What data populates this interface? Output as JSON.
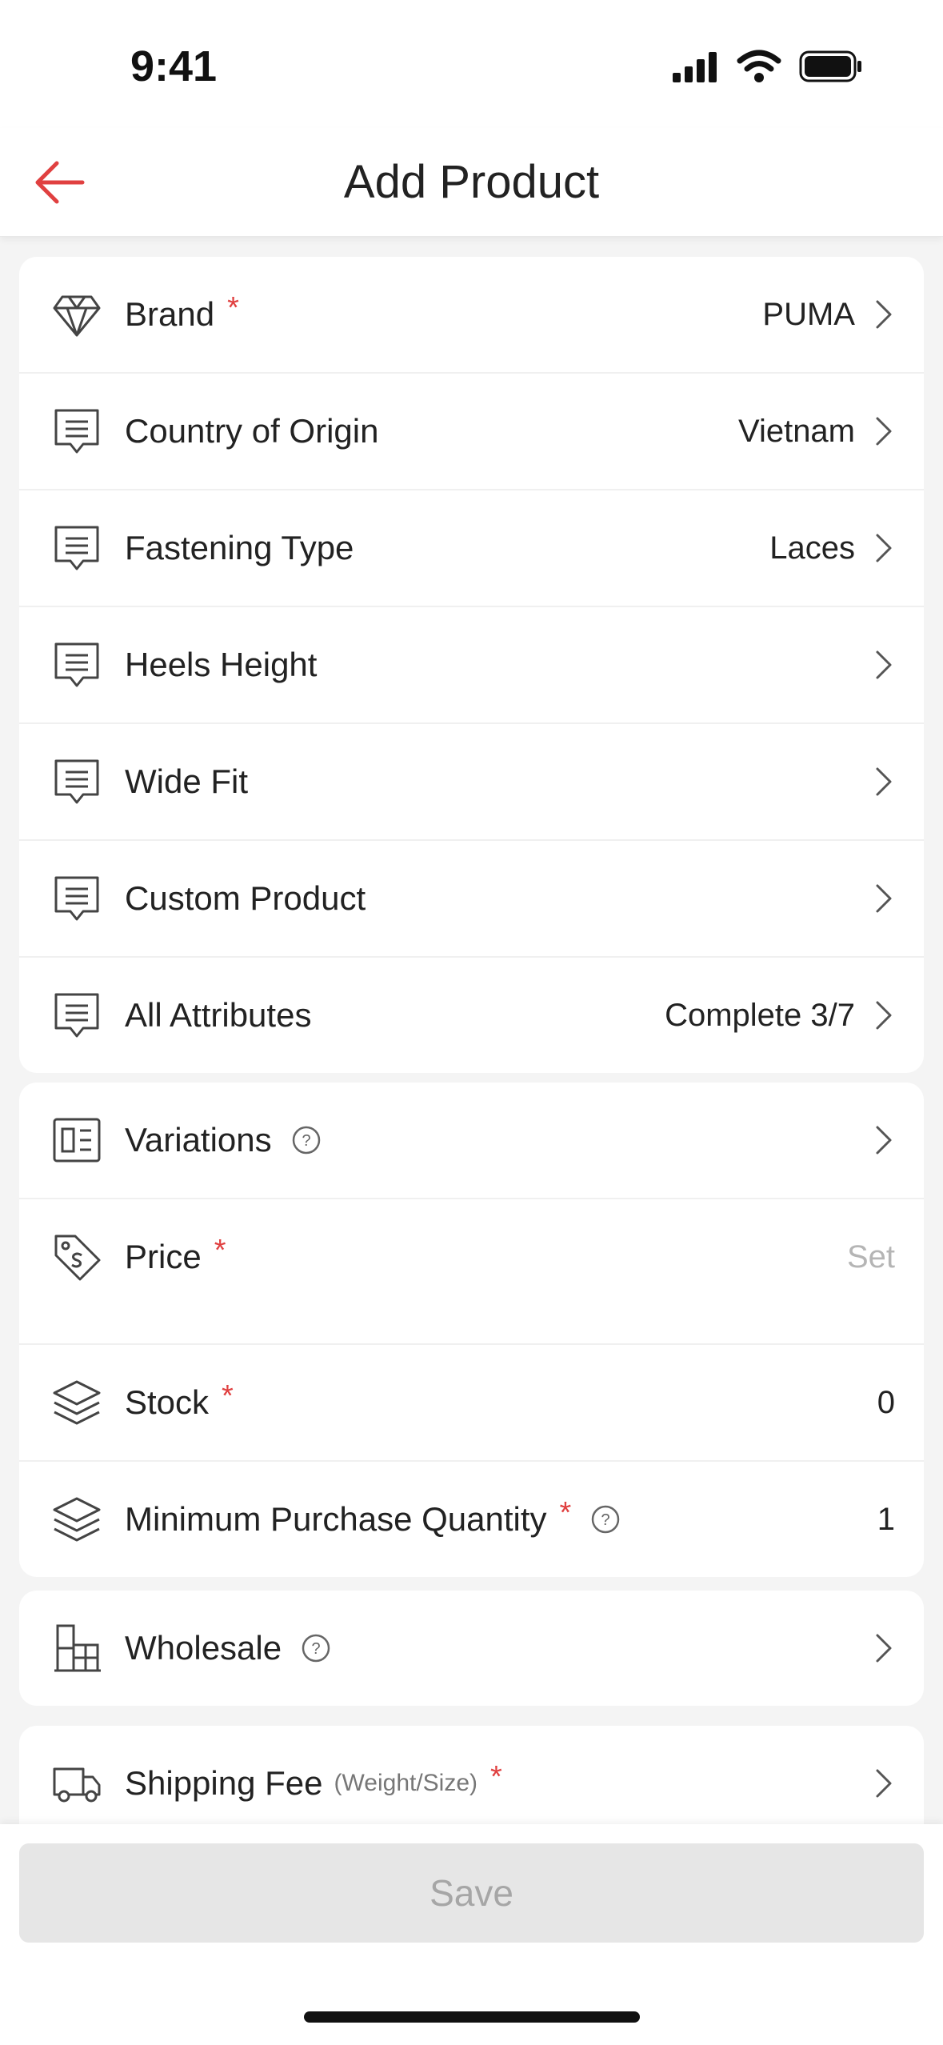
{
  "status": {
    "time": "9:41"
  },
  "nav": {
    "title": "Add Product"
  },
  "attributes": [
    {
      "label": "Brand",
      "required": "*",
      "value": "PUMA",
      "icon": "diamond-icon"
    },
    {
      "label": "Country of Origin",
      "value": "Vietnam",
      "icon": "comment-list-icon"
    },
    {
      "label": "Fastening Type",
      "value": "Laces",
      "icon": "comment-list-icon"
    },
    {
      "label": "Heels Height",
      "value": "",
      "icon": "comment-list-icon"
    },
    {
      "label": "Wide Fit",
      "value": "",
      "icon": "comment-list-icon"
    },
    {
      "label": "Custom Product",
      "value": "",
      "icon": "comment-list-icon"
    },
    {
      "label": "All Attributes",
      "value": "Complete 3/7",
      "icon": "comment-list-icon"
    }
  ],
  "sales": {
    "variations": {
      "label": "Variations",
      "help": "?"
    },
    "price": {
      "label": "Price",
      "required": "*",
      "placeholder": "Set"
    },
    "stock": {
      "label": "Stock",
      "required": "*",
      "value": "0"
    },
    "min_qty": {
      "label": "Minimum Purchase Quantity",
      "required": "*",
      "help": "?",
      "value": "1"
    }
  },
  "wholesale": {
    "label": "Wholesale",
    "help": "?"
  },
  "shipping": {
    "label": "Shipping Fee",
    "sub": "(Weight/Size)",
    "required": "*"
  },
  "footer": {
    "save_label": "Save"
  },
  "colors": {
    "accent": "#e04040",
    "disabled_bg": "#e6e6e6",
    "disabled_text": "#a6a6a6"
  }
}
